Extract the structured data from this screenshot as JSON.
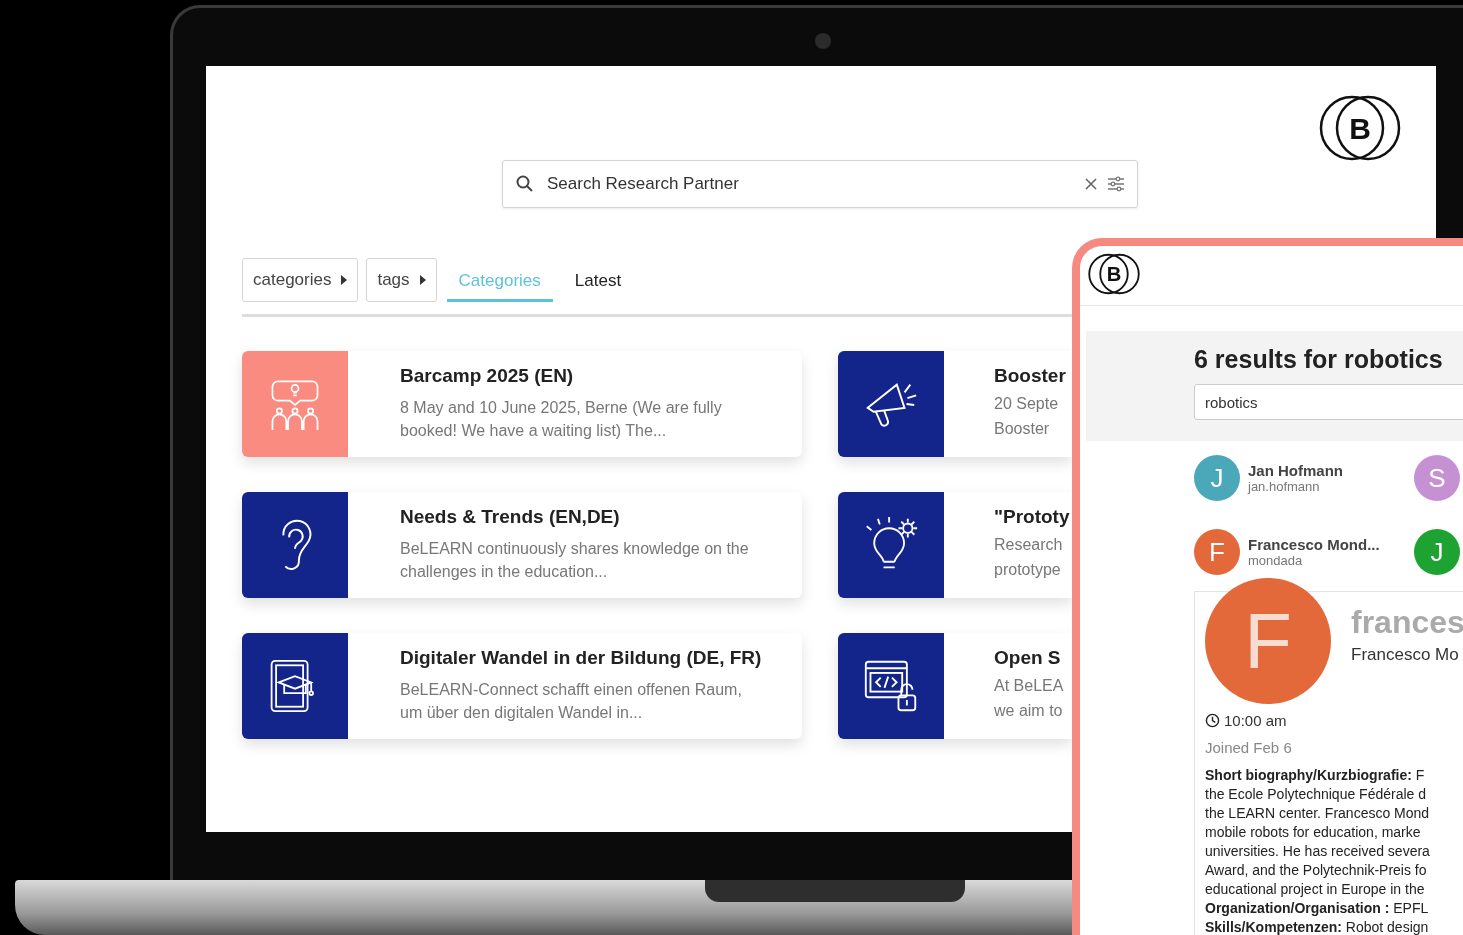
{
  "laptop": {
    "logo": "B",
    "search": {
      "placeholder": "Search Research Partner"
    },
    "filters": [
      {
        "label": "categories"
      },
      {
        "label": "tags"
      }
    ],
    "tabs": [
      {
        "label": "Categories",
        "selected": true
      },
      {
        "label": "Latest",
        "selected": false
      }
    ],
    "left_cards": [
      {
        "title": "Barcamp 2025 (EN)",
        "description": "8 May and 10 June 2025, Berne (We are fully booked! We have a waiting list) The...",
        "color": "#f98b80"
      },
      {
        "title": "Needs & Trends (EN,DE)",
        "description": "BeLEARN continuously shares knowledge on the challenges in the education...",
        "color": "#13258a"
      },
      {
        "title": "Digitaler Wandel in der Bildung (DE, FR)",
        "description": "BeLEARN-Connect schafft einen offenen Raum, um über den digitalen Wandel in...",
        "color": "#13258a"
      }
    ],
    "right_cards": [
      {
        "title": "Booster",
        "description_lines": [
          "20 Septe",
          "Booster"
        ],
        "color": "#13258a"
      },
      {
        "title": "\"Prototy",
        "description_lines": [
          "Research",
          "prototype"
        ],
        "color": "#13258a"
      },
      {
        "title": "Open S",
        "description_lines": [
          "At BeLEA",
          "we aim to"
        ],
        "color": "#13258a"
      }
    ]
  },
  "phone": {
    "logo": "B",
    "heading": "6 results for robotics",
    "search": {
      "value": "robotics"
    },
    "people": [
      {
        "initial": "J",
        "name": "Jan Hofmann",
        "username": "jan.hofmann",
        "color": "#4aa8b9"
      },
      {
        "initial": "S",
        "color": "#c691d3"
      },
      {
        "initial": "F",
        "name": "Francesco Mond...",
        "username": "mondada",
        "color": "#e3693a"
      },
      {
        "initial": "J",
        "color": "#1ea332"
      }
    ],
    "profile": {
      "initial": "F",
      "color": "#e3693a",
      "handle": "frances",
      "name": "Francesco Mo",
      "time": "10:00 am",
      "joined": "Joined Feb 6",
      "bio_lines": [
        "**Short biography/Kurzbiografie:** F",
        "the Ecole Polytechnique Fédérale d",
        "the LEARN center. Francesco Mond",
        "mobile robots for education, marke",
        "universities. He has received severa",
        "Award, and the Polytechnik-Preis fo",
        "educational project in Europe in the",
        "**Organization/Organisation :** EPFL",
        "**Skills/Kompetenzen:** Robot design"
      ]
    }
  }
}
